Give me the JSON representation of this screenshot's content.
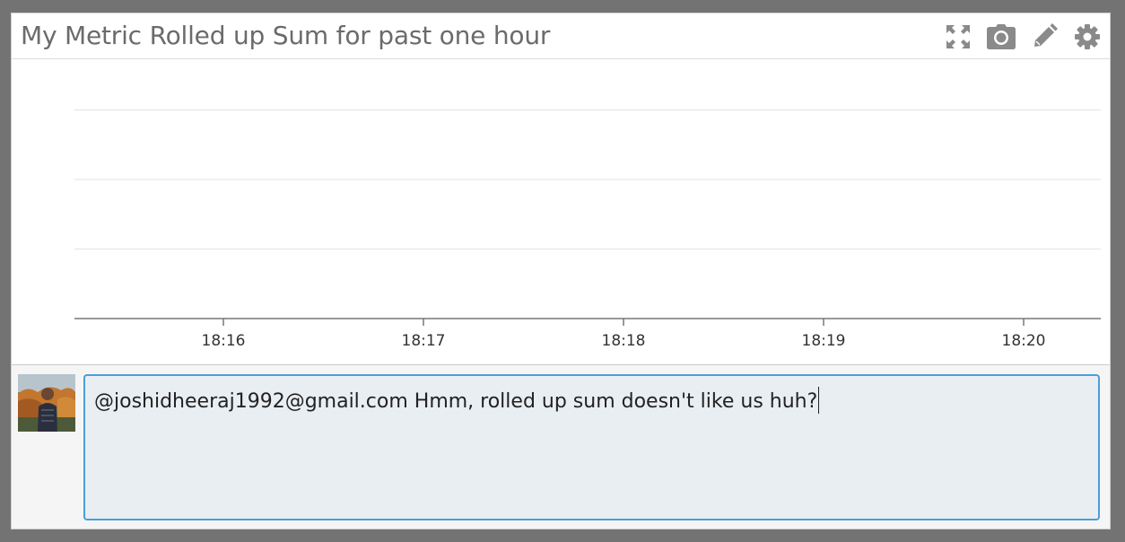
{
  "widget": {
    "title": "My Metric Rolled up Sum for past one hour",
    "tools": [
      {
        "name": "expand",
        "icon": "expand-icon"
      },
      {
        "name": "snapshot",
        "icon": "camera-icon"
      },
      {
        "name": "edit",
        "icon": "pencil-icon"
      },
      {
        "name": "settings",
        "icon": "gear-icon"
      }
    ]
  },
  "chart_data": {
    "type": "line",
    "title": "My Metric Rolled up Sum for past one hour",
    "xlabel": "",
    "ylabel": "",
    "x_ticks": [
      "18:16",
      "18:17",
      "18:18",
      "18:19",
      "18:20"
    ],
    "series": [],
    "grid": true,
    "y_gridlines": 3
  },
  "comment": {
    "text": "@joshidheeraj1992@gmail.com Hmm, rolled up sum doesn't like us huh?",
    "avatar": "user-avatar"
  },
  "colors": {
    "accent": "#4a9fd8",
    "comment_bg": "#e9eef3",
    "icon": "#8a8a8a"
  }
}
